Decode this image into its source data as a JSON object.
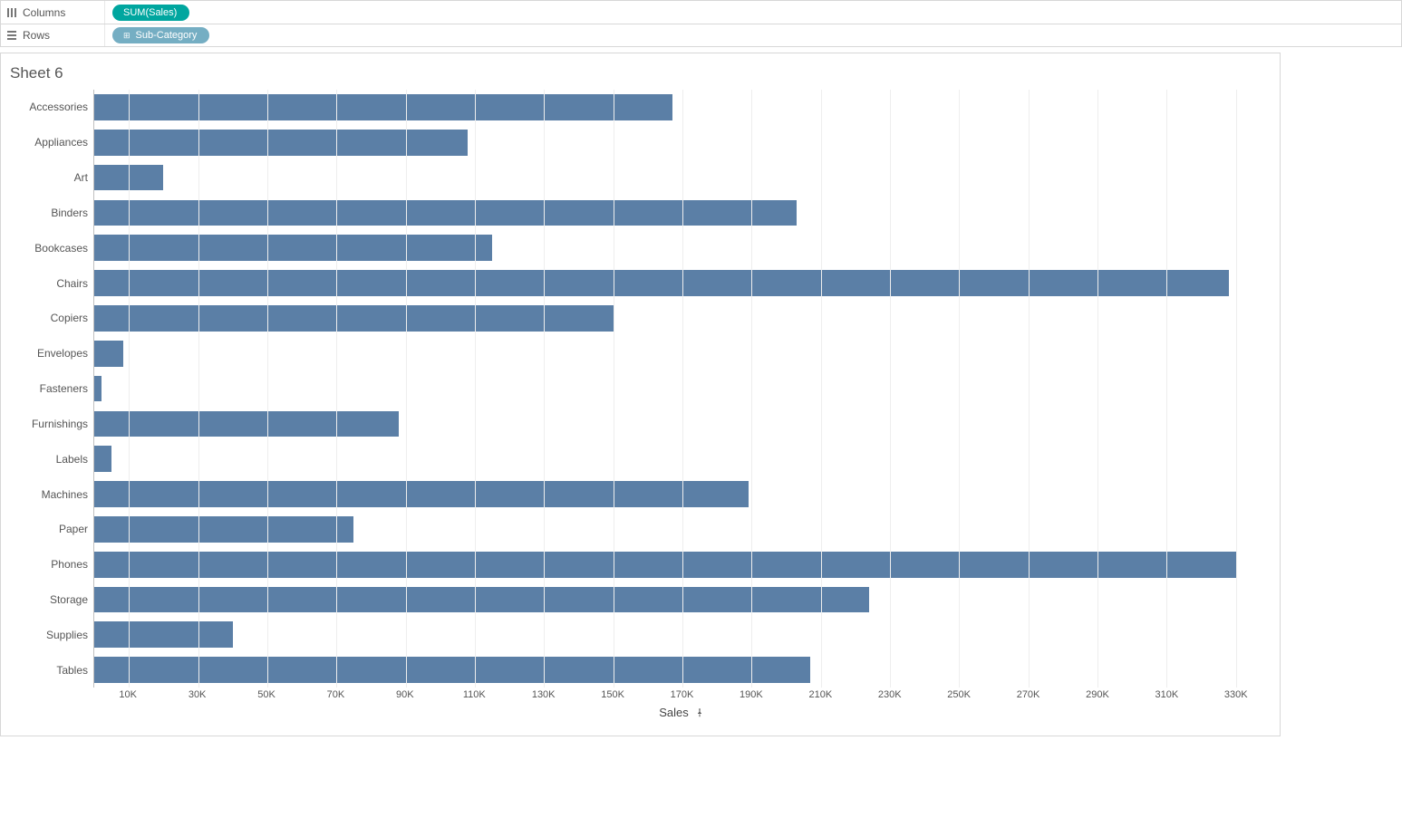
{
  "shelves": {
    "columns_label": "Columns",
    "rows_label": "Rows",
    "columns_pill": "SUM(Sales)",
    "rows_pill": "Sub-Category"
  },
  "sheet_title": "Sheet 6",
  "axis": {
    "title": "Sales",
    "ticks": [
      "10K",
      "30K",
      "50K",
      "70K",
      "90K",
      "110K",
      "130K",
      "150K",
      "170K",
      "190K",
      "210K",
      "230K",
      "250K",
      "270K",
      "290K",
      "310K",
      "330K"
    ],
    "tick_values": [
      10000,
      30000,
      50000,
      70000,
      90000,
      110000,
      130000,
      150000,
      170000,
      190000,
      210000,
      230000,
      250000,
      270000,
      290000,
      310000,
      330000
    ],
    "max": 340000
  },
  "chart_data": {
    "type": "bar",
    "title": "Sheet 6",
    "xlabel": "Sales",
    "ylabel": "Sub-Category",
    "xlim": [
      0,
      340000
    ],
    "categories": [
      "Accessories",
      "Appliances",
      "Art",
      "Binders",
      "Bookcases",
      "Chairs",
      "Copiers",
      "Envelopes",
      "Fasteners",
      "Furnishings",
      "Labels",
      "Machines",
      "Paper",
      "Phones",
      "Storage",
      "Supplies",
      "Tables"
    ],
    "values": [
      167000,
      108000,
      20000,
      203000,
      115000,
      328000,
      150000,
      8500,
      2000,
      88000,
      5000,
      189000,
      75000,
      330000,
      224000,
      40000,
      207000
    ]
  }
}
